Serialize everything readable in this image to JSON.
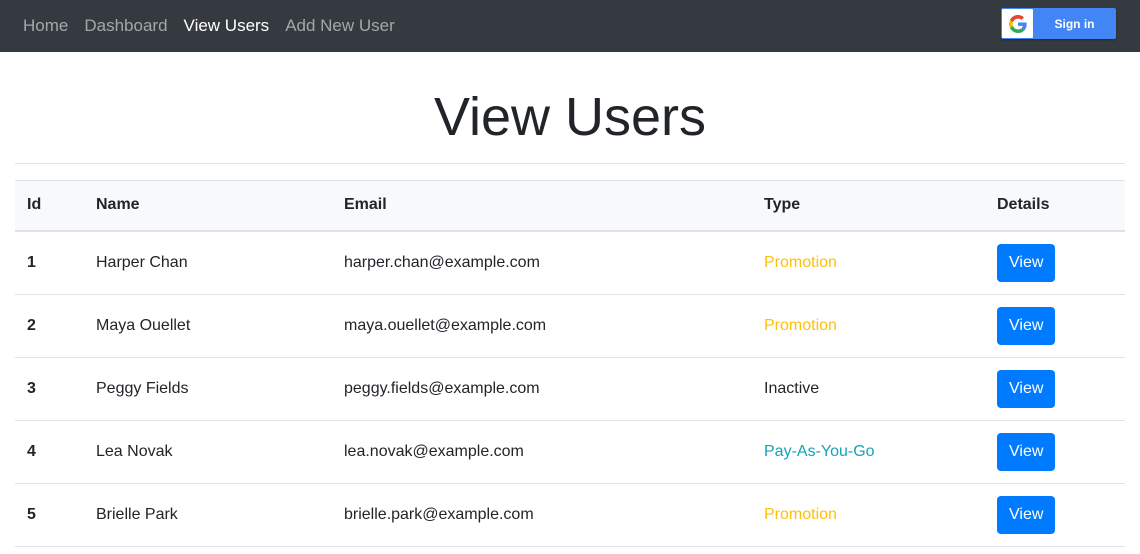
{
  "nav": {
    "items": [
      {
        "label": "Home",
        "active": false
      },
      {
        "label": "Dashboard",
        "active": false
      },
      {
        "label": "View Users",
        "active": true
      },
      {
        "label": "Add New User",
        "active": false
      }
    ],
    "signin_label": "Sign in"
  },
  "page": {
    "title": "View Users"
  },
  "table": {
    "headers": [
      "Id",
      "Name",
      "Email",
      "Type",
      "Details"
    ],
    "rows": [
      {
        "id": "1",
        "name": "Harper Chan",
        "email": "harper.chan@example.com",
        "type": "Promotion",
        "type_color": "#ffc107",
        "action": "View"
      },
      {
        "id": "2",
        "name": "Maya Ouellet",
        "email": "maya.ouellet@example.com",
        "type": "Promotion",
        "type_color": "#ffc107",
        "action": "View"
      },
      {
        "id": "3",
        "name": "Peggy Fields",
        "email": "peggy.fields@example.com",
        "type": "Inactive",
        "type_color": "#212529",
        "action": "View"
      },
      {
        "id": "4",
        "name": "Lea Novak",
        "email": "lea.novak@example.com",
        "type": "Pay-As-You-Go",
        "type_color": "#17a2b8",
        "action": "View"
      },
      {
        "id": "5",
        "name": "Brielle Park",
        "email": "brielle.park@example.com",
        "type": "Promotion",
        "type_color": "#ffc107",
        "action": "View"
      }
    ]
  },
  "colors": {
    "navbar_bg": "#343a40",
    "primary_button": "#007bff",
    "google_blue": "#4285f4"
  }
}
